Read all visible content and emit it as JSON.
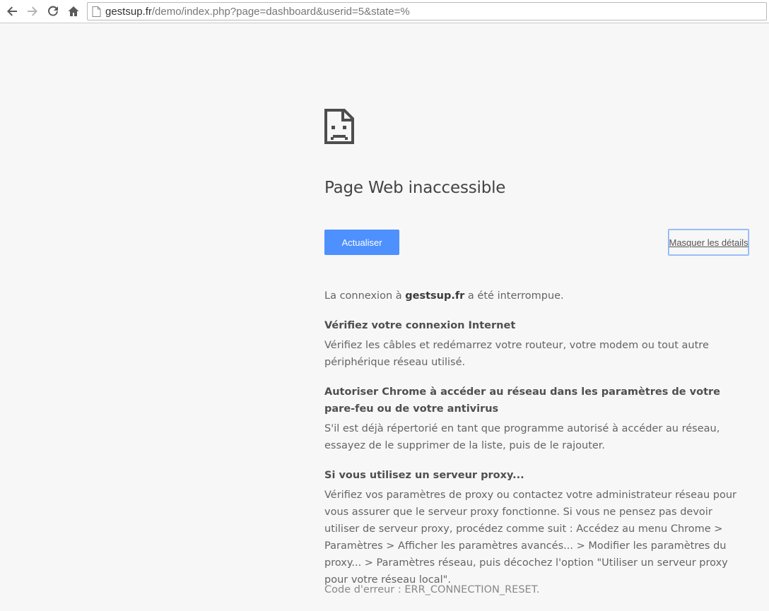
{
  "browser": {
    "url_host": "gestsup.fr",
    "url_path": "/demo/index.php?page=dashboard&userid=5&state=%"
  },
  "error_page": {
    "title": "Page Web inaccessible",
    "reload_label": "Actualiser",
    "details_label": "Masquer les détails",
    "summary_prefix": "La connexion à ",
    "summary_host": "gestsup.fr",
    "summary_suffix": " a été interrompue.",
    "suggestions": [
      {
        "heading": "Vérifiez votre connexion Internet",
        "body": "Vérifiez les câbles et redémarrez votre routeur, votre modem ou tout autre périphérique réseau utilisé."
      },
      {
        "heading": "Autoriser Chrome à accéder au réseau dans les paramètres de votre pare-feu ou de votre antivirus",
        "body": "S'il est déjà répertorié en tant que programme autorisé à accéder au réseau, essayez de le supprimer de la liste, puis de le rajouter."
      },
      {
        "heading": "Si vous utilisez un serveur proxy...",
        "body": "Vérifiez vos paramètres de proxy ou contactez votre administrateur réseau pour vous assurer que le serveur proxy fonctionne. Si vous ne pensez pas devoir utiliser de serveur proxy, procédez comme suit : Accédez au menu Chrome > Paramètres > Afficher les paramètres avancés... > Modifier les paramètres du proxy... > Paramètres réseau, puis décochez l'option \"Utiliser un serveur proxy pour votre réseau local\"."
      }
    ],
    "error_code": "Code d'erreur : ERR_CONNECTION_RESET."
  },
  "icons": {
    "back": "back-arrow-icon",
    "forward": "forward-arrow-icon",
    "reload": "reload-icon",
    "home": "home-icon",
    "page": "page-icon",
    "error": "sad-document-icon"
  },
  "colors": {
    "accent": "#4d90fe",
    "background": "#f7f7f7"
  }
}
